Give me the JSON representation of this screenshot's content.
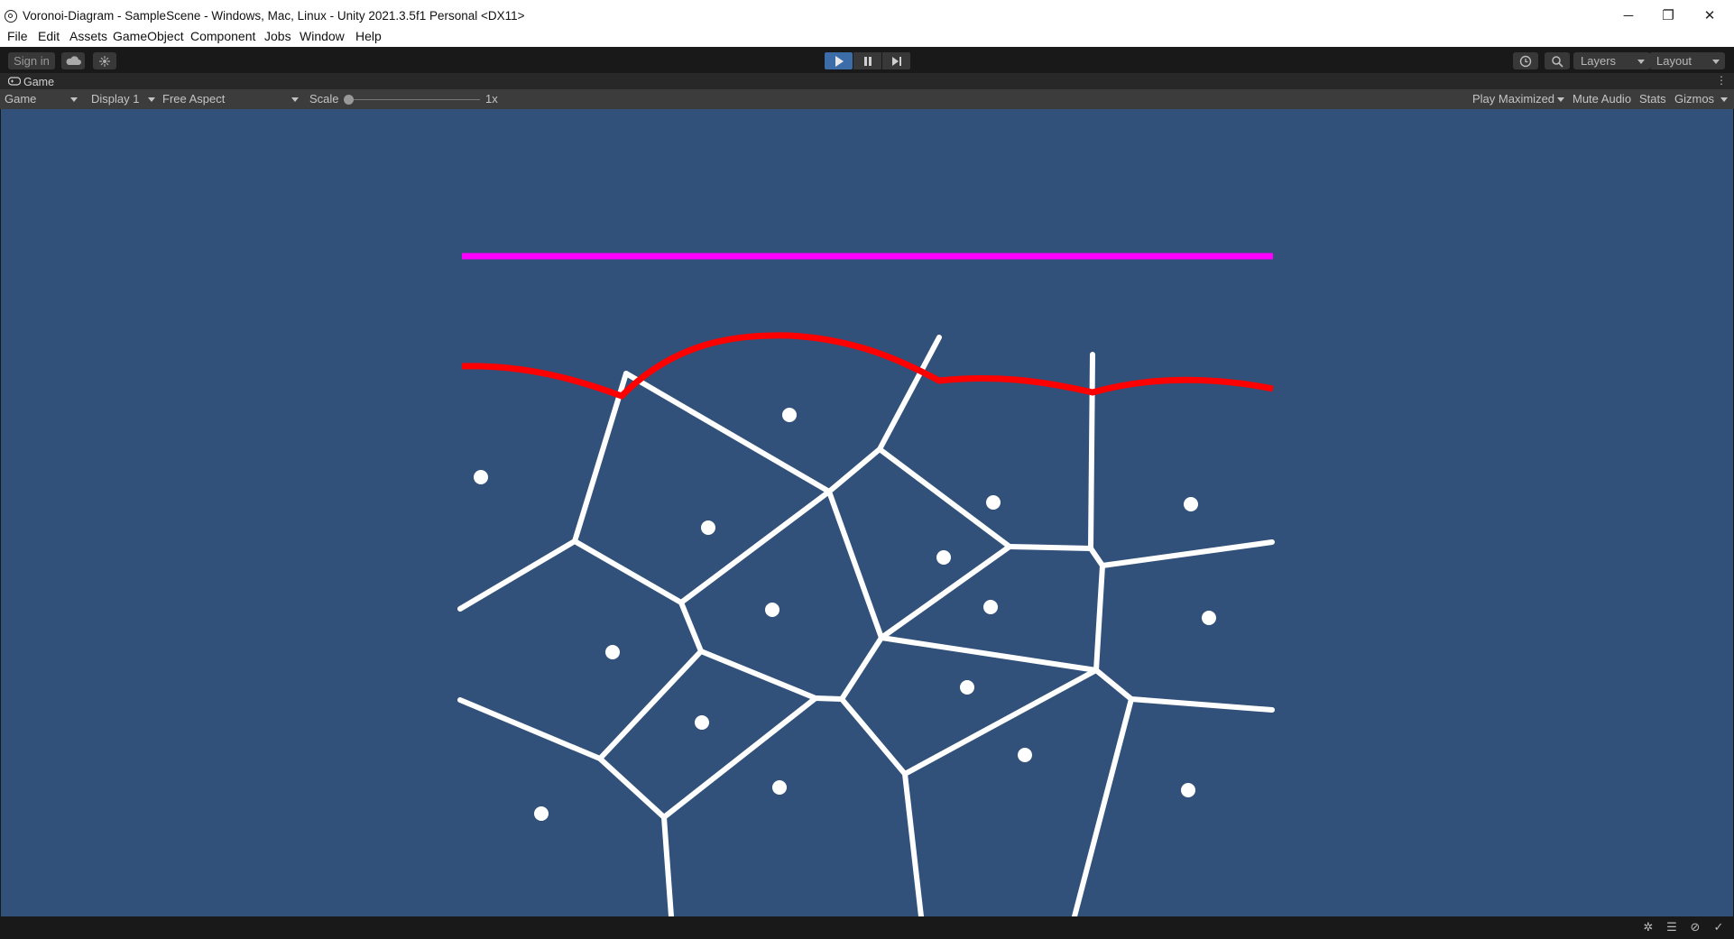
{
  "window": {
    "title": "Voronoi-Diagram - SampleScene - Windows, Mac, Linux - Unity 2021.3.5f1 Personal <DX11>",
    "controls": {
      "minimize": "─",
      "restore": "❐",
      "close": "✕"
    }
  },
  "menu": {
    "items": [
      "File",
      "Edit",
      "Assets",
      "GameObject",
      "Component",
      "Jobs",
      "Window",
      "Help"
    ]
  },
  "toolbar": {
    "sign_in": "Sign in",
    "layers": "Layers",
    "layout": "Layout"
  },
  "tab": {
    "label": "Game"
  },
  "game_options": {
    "mode": "Game",
    "display": "Display 1",
    "aspect": "Free Aspect",
    "scale_label": "Scale",
    "scale_value": "1x",
    "play_maximized": "Play Maximized",
    "mute_audio": "Mute Audio",
    "stats": "Stats",
    "gizmos": "Gizmos"
  },
  "scene": {
    "colors": {
      "background": "#32517a",
      "edges": "#ffffff",
      "beach_line": "#ff0000",
      "sweep_line": "#ff00ff",
      "sites": "#ffffff"
    }
  }
}
